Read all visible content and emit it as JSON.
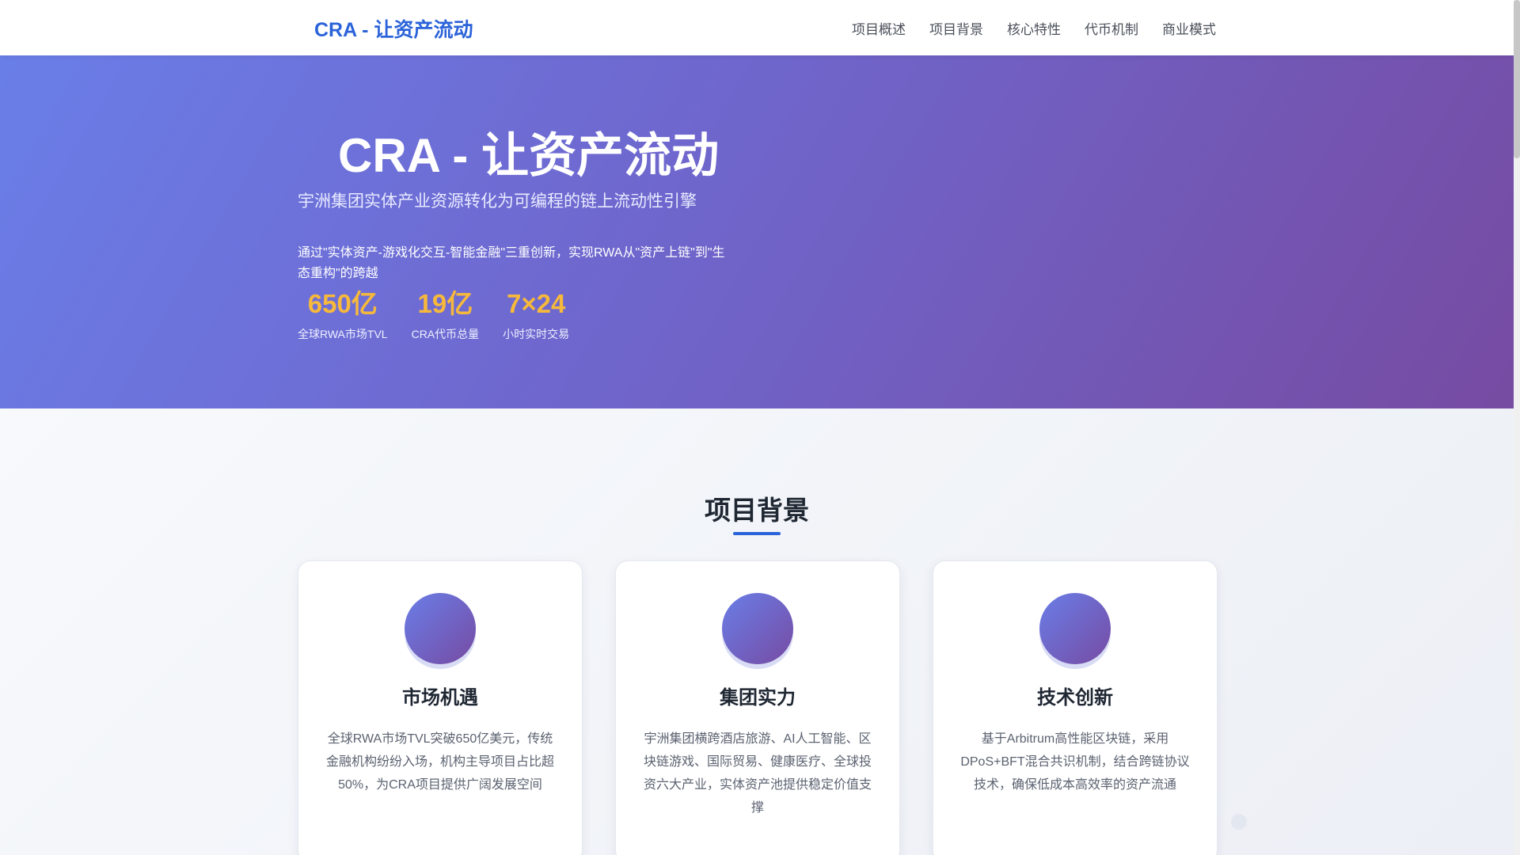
{
  "nav": {
    "logo": "CRA - 让资产流动",
    "items": [
      {
        "label": "项目概述"
      },
      {
        "label": "项目背景"
      },
      {
        "label": "核心特性"
      },
      {
        "label": "代币机制"
      },
      {
        "label": "商业模式"
      }
    ]
  },
  "hero": {
    "title": "CRA - 让资产流动",
    "subtitle": "宇洲集团实体产业资源转化为可编程的链上流动性引擎",
    "description": "通过\"实体资产-游戏化交互-智能金融\"三重创新，实现RWA从\"资产上链\"到\"生态重构\"的跨越",
    "stats": [
      {
        "value": "650亿",
        "label": "全球RWA市场TVL"
      },
      {
        "value": "19亿",
        "label": "CRA代币总量"
      },
      {
        "value": "7×24",
        "label": "小时实时交易"
      }
    ]
  },
  "background": {
    "title": "项目背景",
    "cards": [
      {
        "icon": "gradient-circle-icon",
        "title": "市场机遇",
        "text": "全球RWA市场TVL突破650亿美元，传统金融机构纷纷入场，机构主导项目占比超50%，为CRA项目提供广阔发展空间"
      },
      {
        "icon": "gradient-circle-icon",
        "title": "集团实力",
        "text": "宇洲集团横跨酒店旅游、AI人工智能、区块链游戏、国际贸易、健康医疗、全球投资六大产业，实体资产池提供稳定价值支撑"
      },
      {
        "icon": "gradient-circle-icon",
        "title": "技术创新",
        "text": "基于Arbitrum高性能区块链，采用DPoS+BFT混合共识机制，结合跨链协议技术，确保低成本高效率的资产流通"
      }
    ]
  },
  "colors": {
    "brand": "#2b63d9",
    "hero_gradient_start": "#6a7ee8",
    "hero_gradient_end": "#764ba2",
    "stat_accent": "#f6b93b"
  }
}
